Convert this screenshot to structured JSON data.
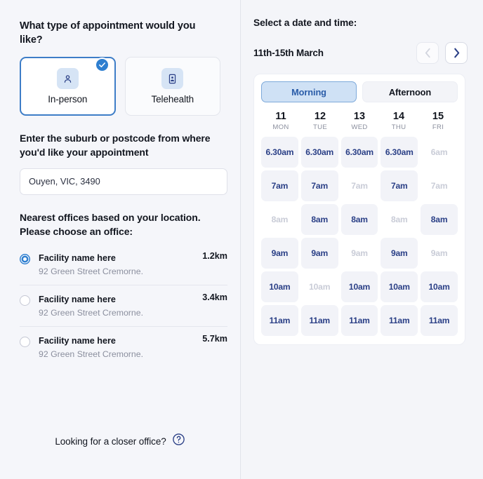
{
  "left": {
    "question": "What type of appointment would you like?",
    "types": [
      {
        "label": "In-person",
        "icon": "person-icon",
        "selected": true
      },
      {
        "label": "Telehealth",
        "icon": "telehealth-device-icon",
        "selected": false
      }
    ],
    "suburb_label": "Enter the suburb or postcode from where you'd like your appointment",
    "suburb_value": "Ouyen, VIC, 3490",
    "suburb_placeholder": "Enter suburb or postcode",
    "offices_label": "Nearest offices based on your location. Please choose an office:",
    "offices": [
      {
        "name": "Facility name here",
        "address": "92 Green Street Cremorne.",
        "distance": "1.2km",
        "selected": true
      },
      {
        "name": "Facility name here",
        "address": "92 Green Street Cremorne.",
        "distance": "3.4km",
        "selected": false
      },
      {
        "name": "Facility name here",
        "address": "92 Green Street Cremorne.",
        "distance": "5.7km",
        "selected": false
      }
    ],
    "closer_text": "Looking for a closer office?",
    "help_icon": "question-circle-icon"
  },
  "right": {
    "title": "Select a date and time:",
    "date_range": "11th-15th March",
    "prev_label": "‹",
    "next_label": "›",
    "segments": [
      {
        "label": "Morning",
        "active": true
      },
      {
        "label": "Afternoon",
        "active": false
      }
    ],
    "days": [
      {
        "num": "11",
        "name": "MON"
      },
      {
        "num": "12",
        "name": "TUE"
      },
      {
        "num": "13",
        "name": "WED"
      },
      {
        "num": "14",
        "name": "THU"
      },
      {
        "num": "15",
        "name": "FRI"
      }
    ],
    "slots": [
      [
        {
          "label": "6.30am",
          "available": true
        },
        {
          "label": "6.30am",
          "available": true
        },
        {
          "label": "6.30am",
          "available": true
        },
        {
          "label": "6.30am",
          "available": true
        },
        {
          "label": "6am",
          "available": false
        }
      ],
      [
        {
          "label": "7am",
          "available": true
        },
        {
          "label": "7am",
          "available": true
        },
        {
          "label": "7am",
          "available": false
        },
        {
          "label": "7am",
          "available": true
        },
        {
          "label": "7am",
          "available": false
        }
      ],
      [
        {
          "label": "8am",
          "available": false
        },
        {
          "label": "8am",
          "available": true
        },
        {
          "label": "8am",
          "available": true
        },
        {
          "label": "8am",
          "available": false
        },
        {
          "label": "8am",
          "available": true
        }
      ],
      [
        {
          "label": "9am",
          "available": true
        },
        {
          "label": "9am",
          "available": true
        },
        {
          "label": "9am",
          "available": false
        },
        {
          "label": "9am",
          "available": true
        },
        {
          "label": "9am",
          "available": false
        }
      ],
      [
        {
          "label": "10am",
          "available": true
        },
        {
          "label": "10am",
          "available": false
        },
        {
          "label": "10am",
          "available": true
        },
        {
          "label": "10am",
          "available": true
        },
        {
          "label": "10am",
          "available": true
        }
      ],
      [
        {
          "label": "11am",
          "available": true
        },
        {
          "label": "11am",
          "available": true
        },
        {
          "label": "11am",
          "available": true
        },
        {
          "label": "11am",
          "available": true
        },
        {
          "label": "11am",
          "available": true
        }
      ]
    ]
  },
  "colors": {
    "accent": "#2f7fd0",
    "slot_text": "#2a3f86",
    "disabled": "#c9ccd7",
    "segment_active_bg": "#cfe1f5"
  }
}
